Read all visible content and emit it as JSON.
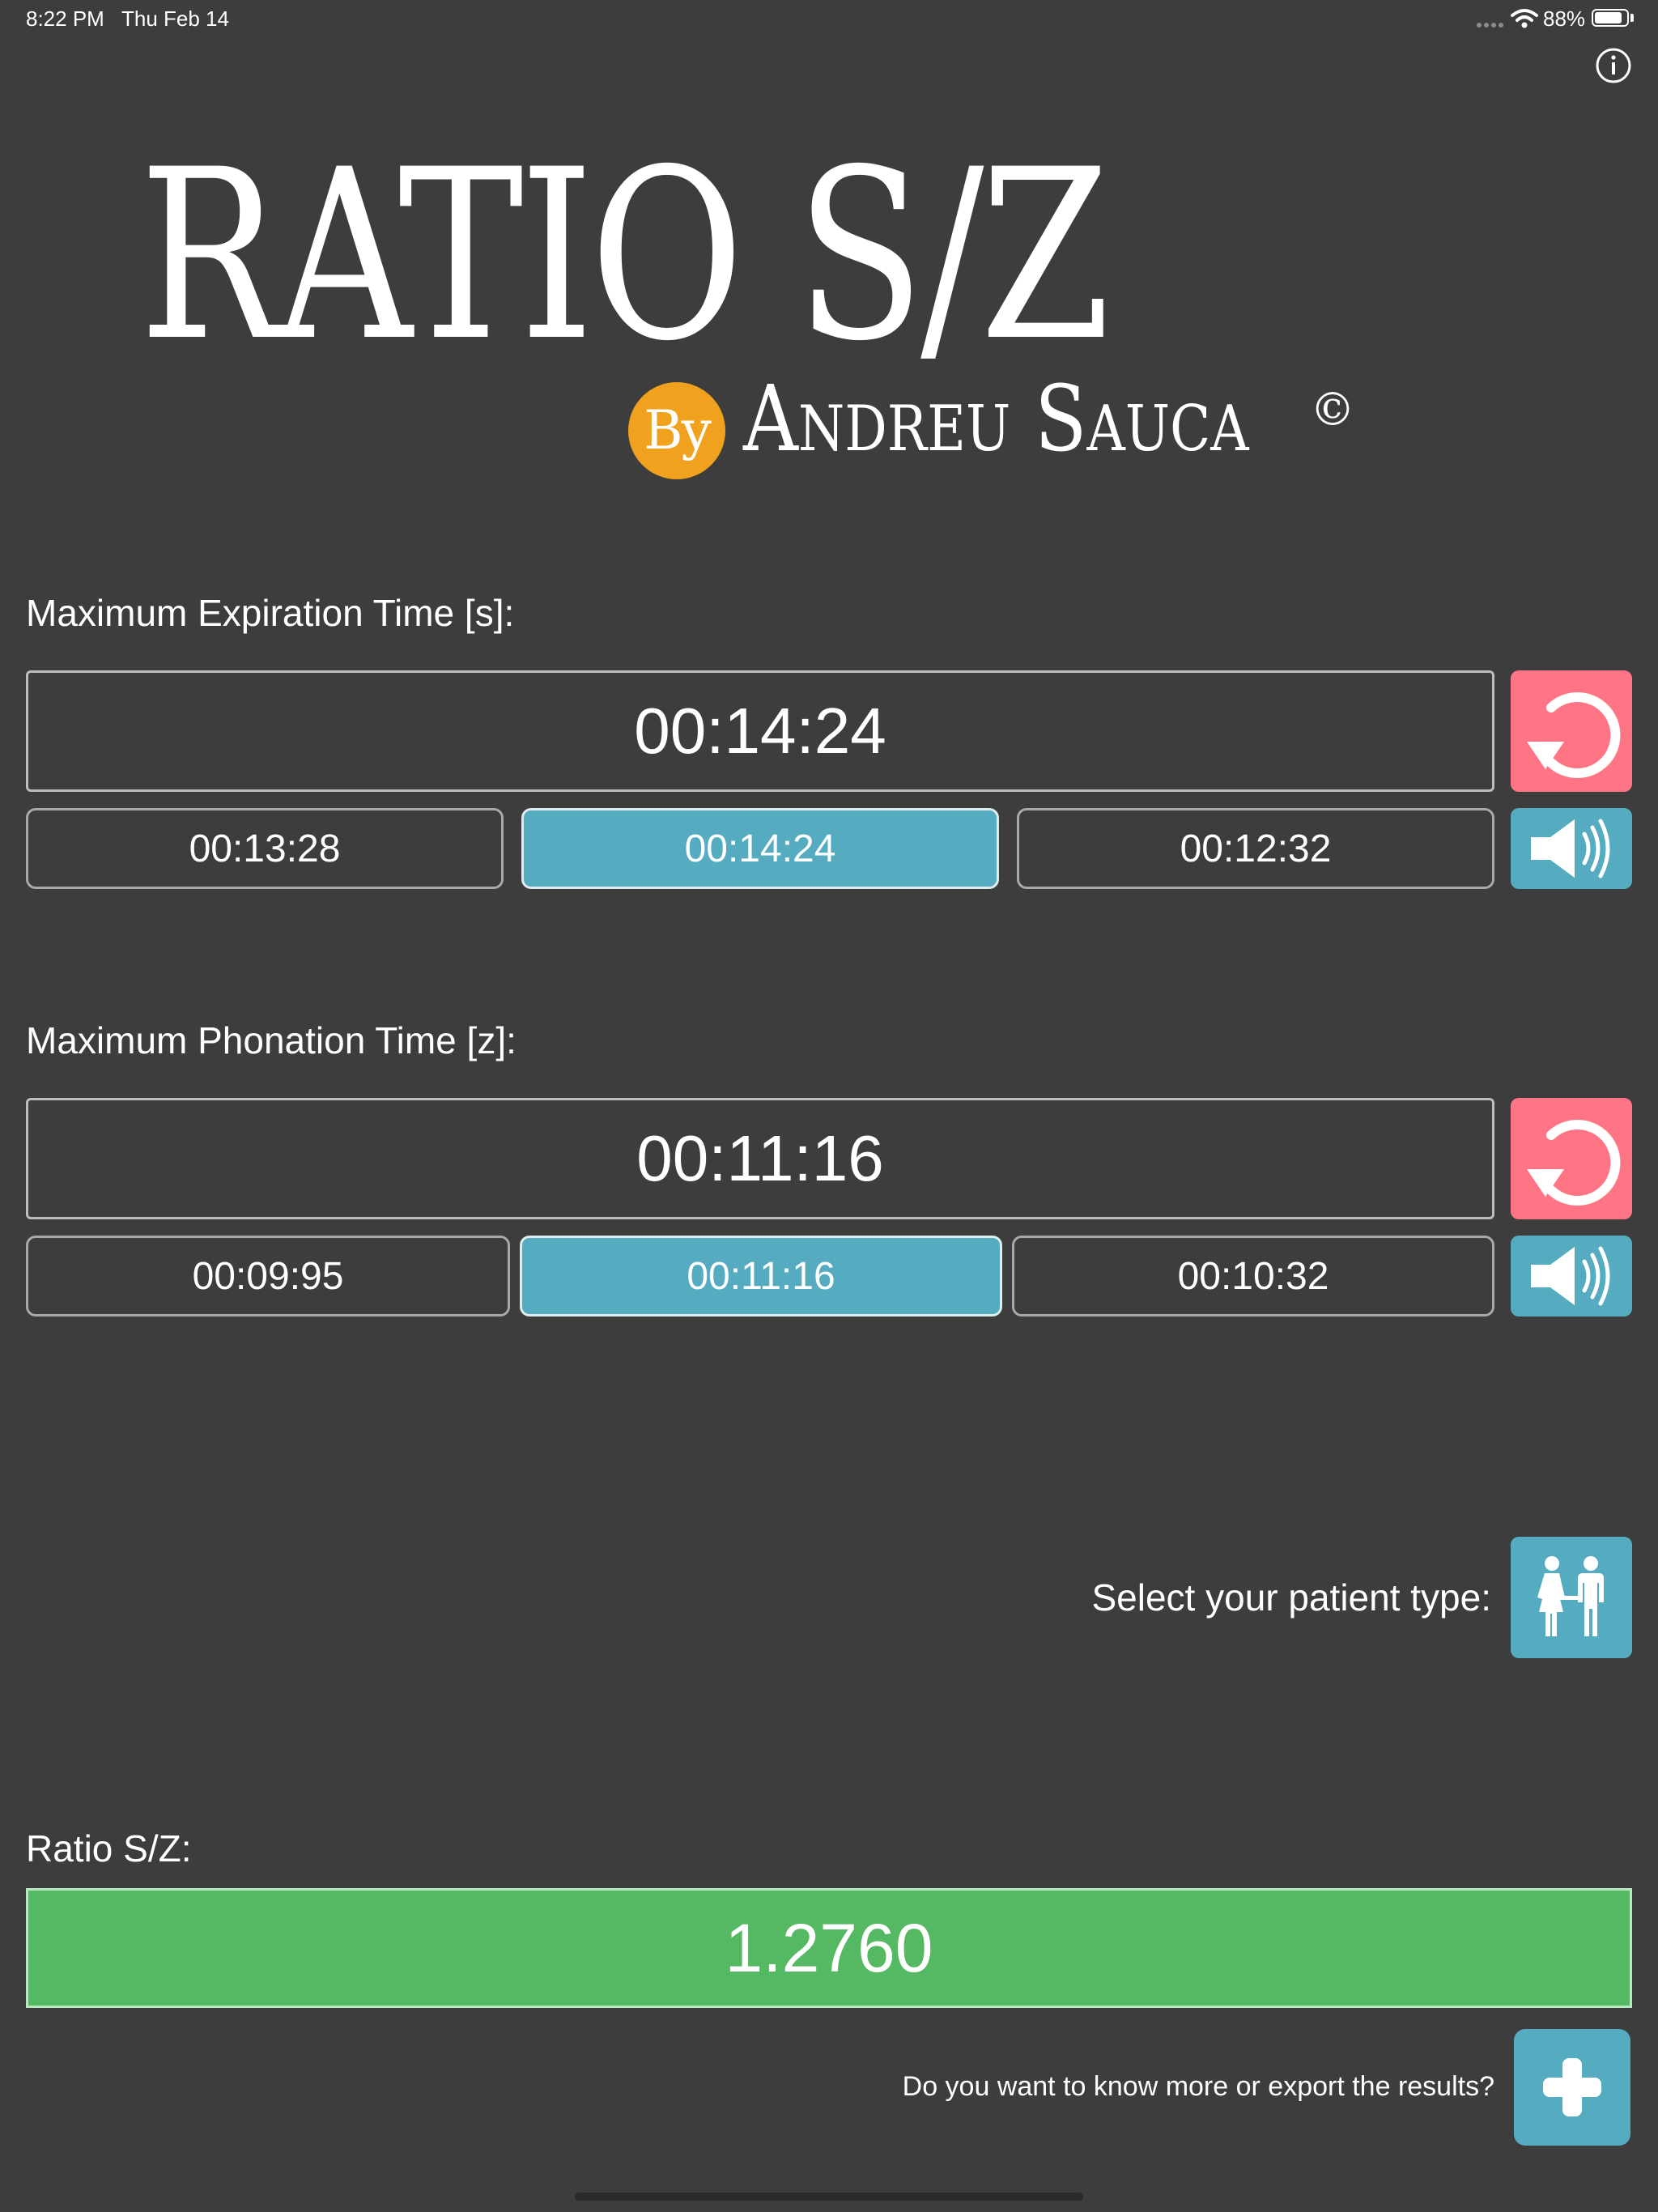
{
  "status_bar": {
    "time": "8:22 PM",
    "date": "Thu Feb 14",
    "battery": "88%",
    "battery_level": 0.88
  },
  "header": {
    "title": "RATIO S/Z",
    "by": "By",
    "author": "Andreu Sauca",
    "copyright": "©"
  },
  "expiration": {
    "label": "Maximum Expiration Time [s]:",
    "current": "00:14:24",
    "trials": [
      "00:13:28",
      "00:14:24",
      "00:12:32"
    ],
    "selected_index": 1
  },
  "phonation": {
    "label": "Maximum Phonation Time [z]:",
    "current": "00:11:16",
    "trials": [
      "00:09:95",
      "00:11:16",
      "00:10:32"
    ],
    "selected_index": 1
  },
  "patient": {
    "label": "Select your patient type:"
  },
  "result": {
    "label": "Ratio S/Z:",
    "value": "1.2760",
    "color": "#55b863"
  },
  "footer": {
    "export_prompt": "Do you want to know more or export the results?"
  },
  "colors": {
    "background": "#3d3d3d",
    "accent_teal": "#55acc0",
    "reset_red": "#ff7585",
    "brand_orange": "#f0a21f"
  },
  "icons": {
    "info": "info-icon",
    "reset": "reset-icon",
    "sound": "speaker-icon",
    "patient": "patient-type-icon",
    "plus": "plus-icon"
  }
}
